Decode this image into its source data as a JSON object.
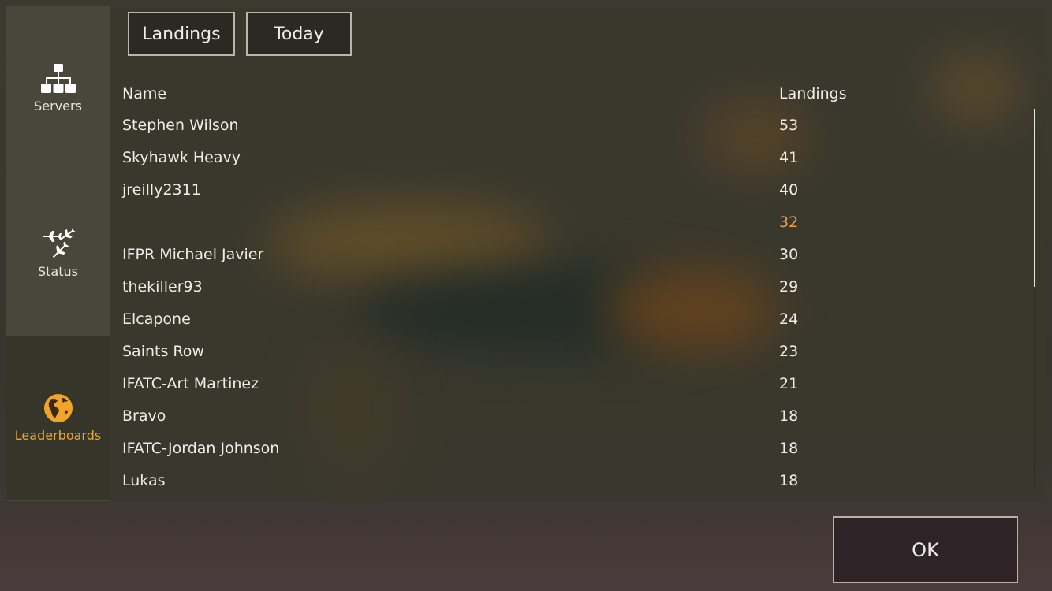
{
  "sidebar": {
    "items": [
      {
        "label": "Servers",
        "icon": "servers-icon",
        "active": false
      },
      {
        "label": "Status",
        "icon": "airplanes-icon",
        "active": false
      },
      {
        "label": "Leaderboards",
        "icon": "globe-icon",
        "active": true
      }
    ]
  },
  "filters": {
    "metric_label": "Landings",
    "period_label": "Today"
  },
  "table": {
    "headers": {
      "name": "Name",
      "value": "Landings"
    },
    "rows": [
      {
        "name": "Stephen Wilson",
        "value": "53"
      },
      {
        "name": "Skyhawk Heavy",
        "value": "41"
      },
      {
        "name": "jreilly2311",
        "value": "40"
      },
      {
        "name": "",
        "value": "32",
        "highlight": true
      },
      {
        "name": "IFPR Michael Javier",
        "value": "30"
      },
      {
        "name": "thekiller93",
        "value": "29"
      },
      {
        "name": "Elcapone",
        "value": "24"
      },
      {
        "name": "Saints Row",
        "value": "23"
      },
      {
        "name": "IFATC-Art Martinez",
        "value": "21"
      },
      {
        "name": "Bravo",
        "value": "18"
      },
      {
        "name": "IFATC-Jordan Johnson",
        "value": "18"
      },
      {
        "name": "Lukas",
        "value": "18"
      }
    ]
  },
  "footer": {
    "ok_label": "OK"
  },
  "colors": {
    "accent": "#f0a52a",
    "highlight_value": "#f0a04a"
  }
}
